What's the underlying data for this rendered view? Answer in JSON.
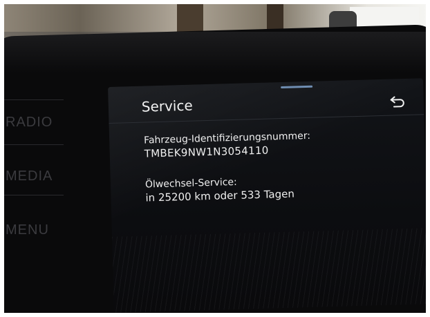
{
  "side_buttons": [
    "RADIO",
    "MEDIA",
    "MENU"
  ],
  "screen": {
    "title": "Service",
    "back_icon": "back-arrow-icon",
    "vin_label": "Fahrzeug-Identifizierungsnummer:",
    "vin_value": "TMBEK9NW1N3054110",
    "oil_label": "Ölwechsel-Service:",
    "oil_value": "in 25200 km oder 533 Tagen"
  },
  "colors": {
    "screen_bg": "#0c0d10",
    "text": "#f0f0f0",
    "accent": "#6f8db1"
  }
}
